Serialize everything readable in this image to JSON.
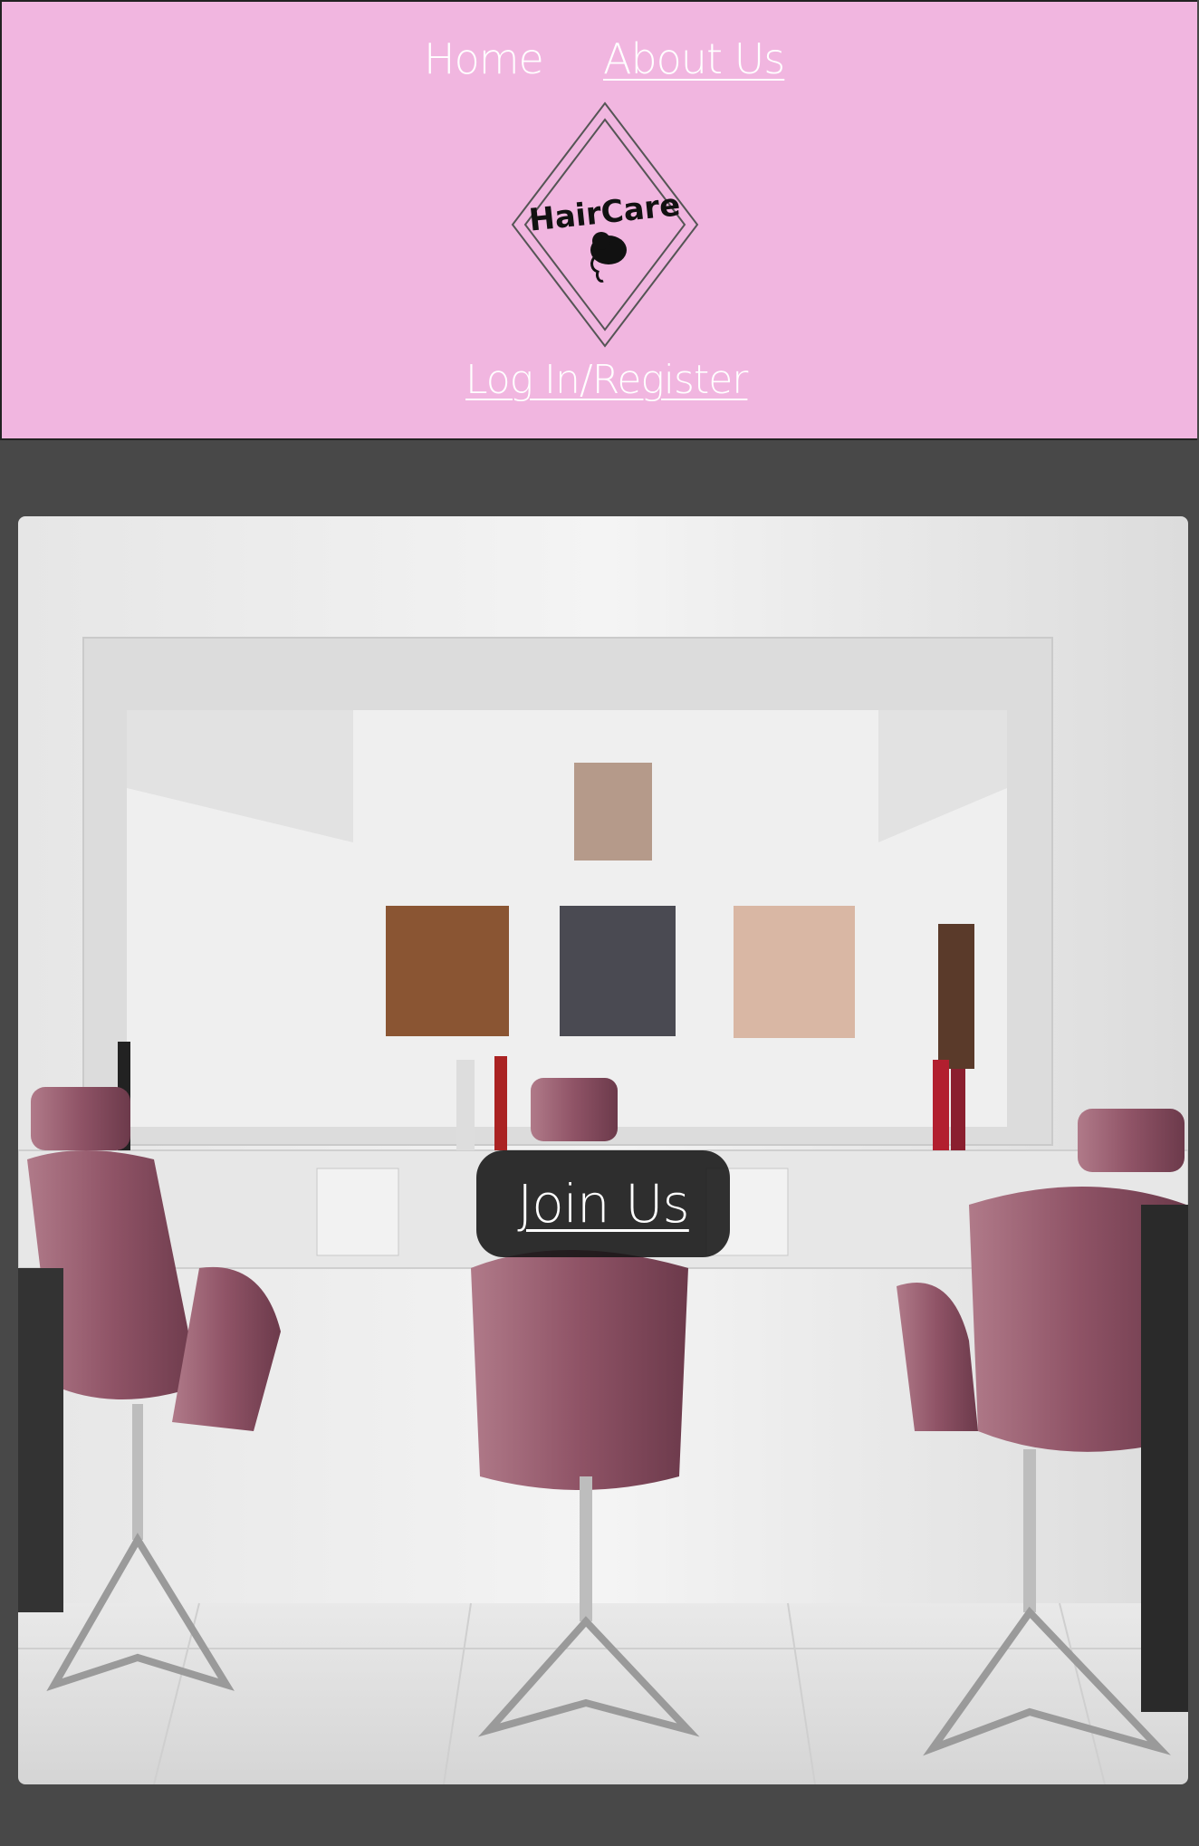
{
  "nav": {
    "home": "Home",
    "about": "About Us",
    "login": "Log In/Register"
  },
  "logo": {
    "text": "HairCare",
    "icon": "woman-profile-icon"
  },
  "hero": {
    "image": "salon-interior-photo",
    "cta": "Join Us"
  },
  "colors": {
    "header_bg": "#f1b6e0",
    "page_bg": "#484848",
    "chair": "#8a4a5c",
    "button_bg": "#141414"
  }
}
